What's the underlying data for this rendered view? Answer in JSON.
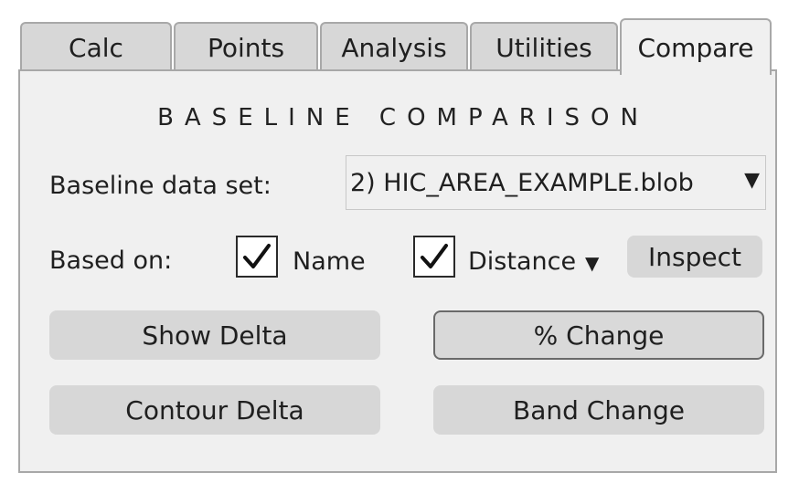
{
  "tabs": [
    {
      "label": "Calc",
      "active": false
    },
    {
      "label": "Points",
      "active": false
    },
    {
      "label": "Analysis",
      "active": false
    },
    {
      "label": "Utilities",
      "active": false
    },
    {
      "label": "Compare",
      "active": true
    }
  ],
  "compare": {
    "title": "BASELINE COMPARISON",
    "baseline_label": "Baseline data set:",
    "baseline_value": "2) HIC_AREA_EXAMPLE.blob",
    "based_on_label": "Based on:",
    "name_checkbox": {
      "label": "Name",
      "checked": true
    },
    "distance_checkbox": {
      "label": "Distance",
      "checked": true
    },
    "inspect_label": "Inspect",
    "buttons": {
      "show_delta": "Show Delta",
      "percent_change": "% Change",
      "contour_delta": "Contour Delta",
      "band_change": "Band Change"
    }
  },
  "icons": {
    "dropdown_arrow": "triangle-down",
    "checkmark": "check"
  },
  "colors": {
    "panel_bg": "#f0f0f0",
    "tab_inactive": "#d7d7d7",
    "button_bg": "#d7d7d7",
    "border": "#a8a8a8"
  }
}
